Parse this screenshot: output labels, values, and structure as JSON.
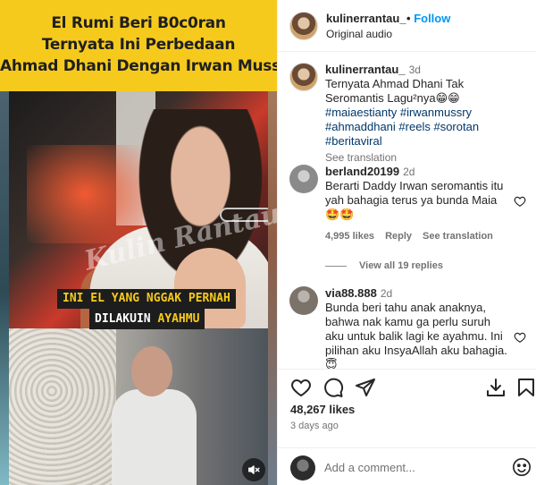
{
  "video": {
    "title_lines": [
      "El Rumi Beri B0c0ran",
      "Ternyata Ini Perbedaan",
      "Ahmad Dhani Dengan Irwan Mussry"
    ],
    "watermark": "Kulin Rantau",
    "caption_line1": "INI EL YANG NGGAK PERNAH",
    "caption_line2_start": "DILAKUIN ",
    "caption_line2_accent": "AYAHMU",
    "colors": {
      "banner": "#f6ca1d",
      "caption_text": "#f6ca1d"
    },
    "mute_icon": "speaker-muted-icon"
  },
  "header": {
    "username": "kulinerrantau_",
    "separator": "•",
    "follow_label": "Follow",
    "audio": "Original audio"
  },
  "caption": {
    "username": "kulinerrantau_",
    "time": "3d",
    "text": "Ternyata Ahmad Dhani Tak Seromantis Lagu²nya😁😁 ",
    "hashtags": [
      "#maiaestianty",
      "#irwanmussry",
      "#ahmaddhani",
      "#reels",
      "#sorotan",
      "#beritaviral"
    ],
    "see_translation": "See translation"
  },
  "comments": [
    {
      "username": "berland20199",
      "time": "2d",
      "text": "Berarti Daddy Irwan seromantis itu yah bahagia terus ya bunda Maia🤩🤩",
      "likes": "4,995 likes",
      "reply": "Reply",
      "see_translation": "See translation",
      "view_replies": "View all 19 replies"
    },
    {
      "username": "via88.888",
      "time": "2d",
      "text": "Bunda beri tahu anak anaknya, bahwa nak kamu ga perlu suruh aku untuk balik lagi ke ayahmu. Ini pilihan aku InsyaAllah aku bahagia. 😇"
    }
  ],
  "actions": {
    "icons": [
      "heart-icon",
      "comment-icon",
      "share-icon",
      "download-icon",
      "bookmark-icon"
    ]
  },
  "likes": "48,267 likes",
  "time_ago": "3 days ago",
  "add_comment": {
    "placeholder": "Add a comment..."
  },
  "colors": {
    "link": "#0095f6",
    "hashtag": "#00376b",
    "muted": "#737373"
  }
}
